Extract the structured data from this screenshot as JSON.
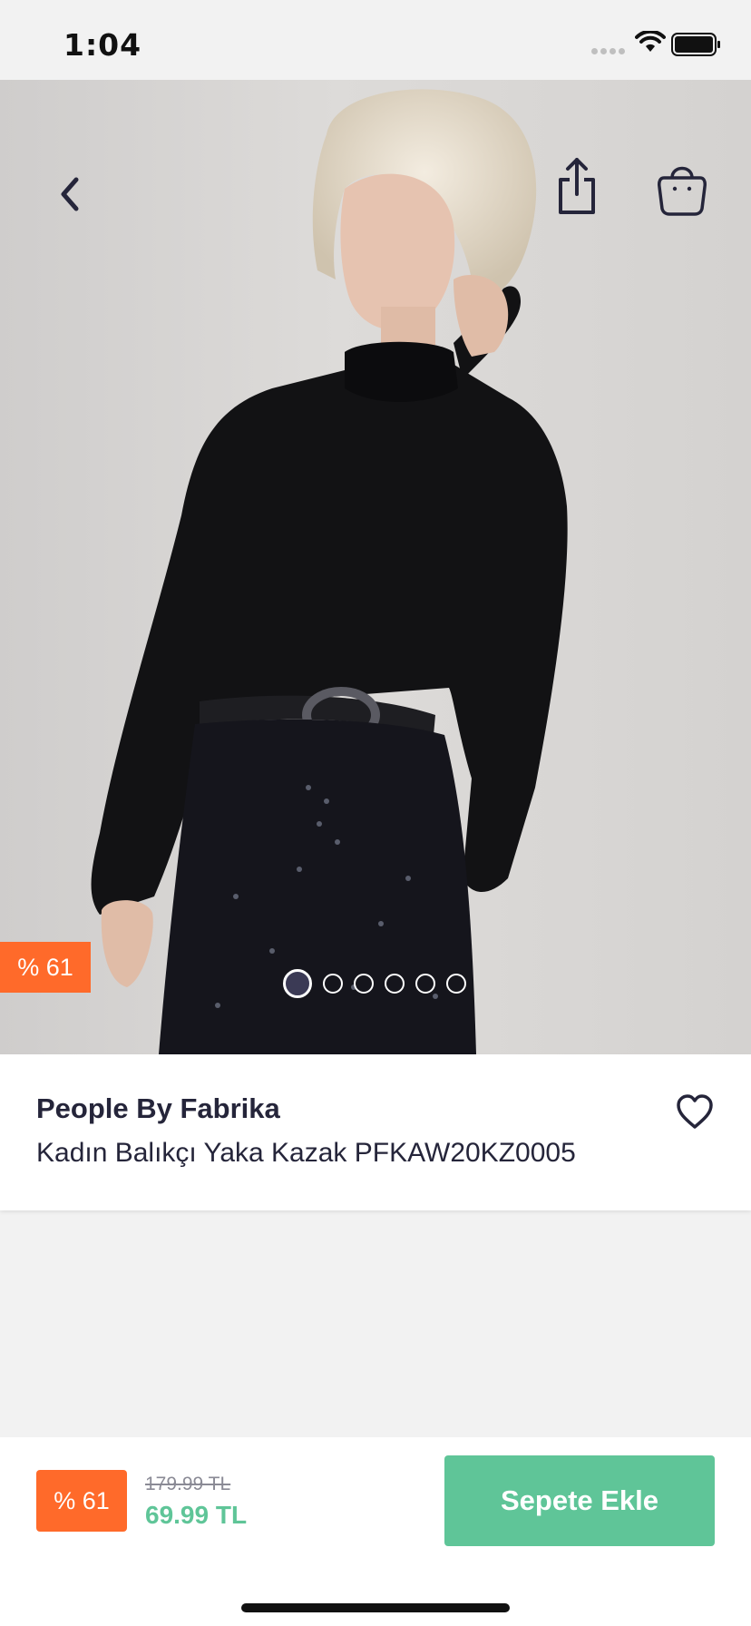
{
  "status_bar": {
    "time": "1:04"
  },
  "product": {
    "brand": "People By Fabrika",
    "name": "Kadın Balıkçı Yaka  Kazak PFKAW20KZ0005",
    "discount_badge": "% 61",
    "image_count": 6,
    "active_image": 1
  },
  "pricing": {
    "discount_badge": "% 61",
    "old_price": "179.99 TL",
    "new_price": "69.99 TL"
  },
  "actions": {
    "add_to_cart_label": "Sepete Ekle"
  },
  "colors": {
    "accent_green": "#5fc598",
    "discount_orange": "#ff6a2a",
    "text_dark": "#25253a"
  }
}
